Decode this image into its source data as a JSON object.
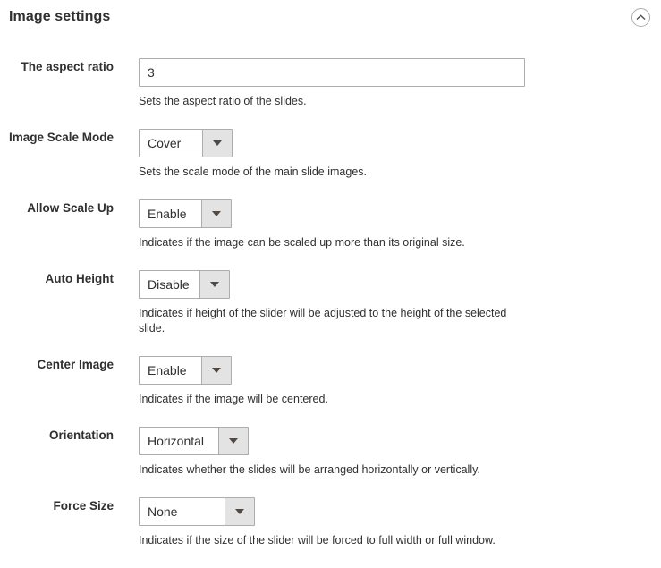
{
  "section": {
    "title": "Image settings",
    "collapse_icon": "chevron-up-circle-icon"
  },
  "fields": [
    {
      "id": "aspect-ratio",
      "label": "The aspect ratio",
      "control": "text",
      "value": "3",
      "note": "Sets the aspect ratio of the slides."
    },
    {
      "id": "image-scale-mode",
      "label": "Image Scale Mode",
      "control": "select",
      "value": "Cover",
      "note": "Sets the scale mode of the main slide images."
    },
    {
      "id": "allow-scale-up",
      "label": "Allow Scale Up",
      "control": "select",
      "value": "Enable",
      "note": "Indicates if the image can be scaled up more than its original size."
    },
    {
      "id": "auto-height",
      "label": "Auto Height",
      "control": "select",
      "value": "Disable",
      "note": "Indicates if height of the slider will be adjusted to the height of the selected slide."
    },
    {
      "id": "center-image",
      "label": "Center Image",
      "control": "select",
      "value": "Enable",
      "note": "Indicates if the image will be centered."
    },
    {
      "id": "orientation",
      "label": "Orientation",
      "control": "select",
      "value": "Horizontal",
      "note": "Indicates whether the slides will be arranged horizontally or vertically."
    },
    {
      "id": "force-size",
      "label": "Force Size",
      "control": "select",
      "value": "None",
      "note": "Indicates if the size of the slider will be forced to full width or full window."
    }
  ],
  "colors": {
    "text": "#303030",
    "border": "#adadad",
    "select_button_bg": "#e3e3e3",
    "background": "#ffffff"
  }
}
